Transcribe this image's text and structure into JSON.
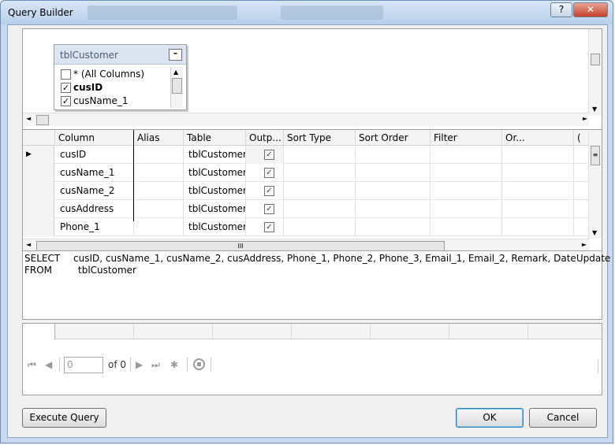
{
  "window": {
    "title": "Query Builder",
    "help_label": "?",
    "close_label": "✕"
  },
  "diagram": {
    "table_name": "tblCustomer",
    "minimize_label": "–",
    "columns": [
      {
        "label": "* (All Columns)",
        "checked": false
      },
      {
        "label": "cusID",
        "checked": true
      },
      {
        "label": "cusName_1",
        "checked": true
      }
    ]
  },
  "grid": {
    "headers": [
      "Column",
      "Alias",
      "Table",
      "Outp...",
      "Sort Type",
      "Sort Order",
      "Filter",
      "Or...",
      "("
    ],
    "rows": [
      {
        "column": "cusID",
        "alias": "",
        "table": "tblCustomer",
        "output": true
      },
      {
        "column": "cusName_1",
        "alias": "",
        "table": "tblCustomer",
        "output": true
      },
      {
        "column": "cusName_2",
        "alias": "",
        "table": "tblCustomer",
        "output": true
      },
      {
        "column": "cusAddress",
        "alias": "",
        "table": "tblCustomer",
        "output": true
      },
      {
        "column": "Phone_1",
        "alias": "",
        "table": "tblCustomer",
        "output": true
      }
    ],
    "check_mark": "✓",
    "scroll_grip": "III"
  },
  "sql": {
    "select_kw": "SELECT",
    "select_cols": "cusID, cusName_1, cusName_2, cusAddress, Phone_1, Phone_2, Phone_3, Email_1, Email_2, Remark, DateUpdate",
    "from_kw": "FROM",
    "from_table": "tblCustomer"
  },
  "results": {
    "position_value": "0",
    "of_label": "of 0"
  },
  "buttons": {
    "execute": "Execute Query",
    "ok": "OK",
    "cancel": "Cancel"
  }
}
